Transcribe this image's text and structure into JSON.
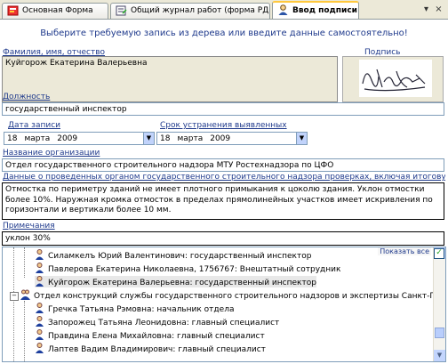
{
  "tabs": [
    {
      "label": "Основная Форма"
    },
    {
      "label": "Общий журнал работ (форма РД)"
    },
    {
      "label": "Ввод подписи"
    }
  ],
  "window_controls": {
    "dropdown": "▾",
    "close": "×"
  },
  "hint": "Выберите требуемую запись из дерева или введите данные самостоятельно!",
  "fio": {
    "label": "Фамилия, имя, отчество",
    "value": "Куйгорож Екатерина Валерьевна"
  },
  "signature": {
    "label": "Подпись"
  },
  "position": {
    "label": "Должность",
    "value": "государственный инспектор"
  },
  "record_date": {
    "label": "Дата записи",
    "day": "18",
    "month": "марта",
    "year": "2009"
  },
  "deadline": {
    "label": "Срок устранения выявленных",
    "day": "18",
    "month": "марта",
    "year": "2009"
  },
  "organization": {
    "label": "Название организации",
    "value": "Отдел государственного строительного надзора МТУ Ростехнадзора по ЦФО"
  },
  "inspection": {
    "label": "Данные о проведенных органом государственного строительного надзора проверках, включая итоговую пр",
    "value": "Отмостка по периметру зданий не имеет плотного примыкания к цоколю здания. Уклон отмостки более 10%. Наружная кромка отмосток в пределах прямолинейных участков имеет искривления по горизонтали и вертикали более 10 мм."
  },
  "remarks": {
    "label": "Примечания",
    "value": "уклон 30%"
  },
  "tree": {
    "show_all": "Показать все",
    "rows": [
      {
        "text": "Силамкелъ Юрий Валентинович:  государственный инспектор",
        "type": "person",
        "level": 2
      },
      {
        "text": "Павлерова Екатерина Николаевна, 1756767:  Внештатный сотрудник",
        "type": "person",
        "level": 2
      },
      {
        "text": "Куйгорож Екатерина Валерьевна:  государственный инспектор",
        "type": "person",
        "level": 2,
        "selected": true
      },
      {
        "text": "Отдел конструкций службы государственного строительного надзоров и экспертизы Санкт-Петерб",
        "type": "group",
        "level": 1
      },
      {
        "text": "Гречка Татьяна Рэмовна:  начальник отдела",
        "type": "person",
        "level": 2
      },
      {
        "text": "Запорожец Татьяна Леонидовна:  главный специалист",
        "type": "person",
        "level": 2
      },
      {
        "text": "Правдина Елена Михайловна:  главный специалист",
        "type": "person",
        "level": 2
      },
      {
        "text": "Лаптев Вадим Владимирович:  главный специалист",
        "type": "person",
        "level": 2
      }
    ]
  }
}
